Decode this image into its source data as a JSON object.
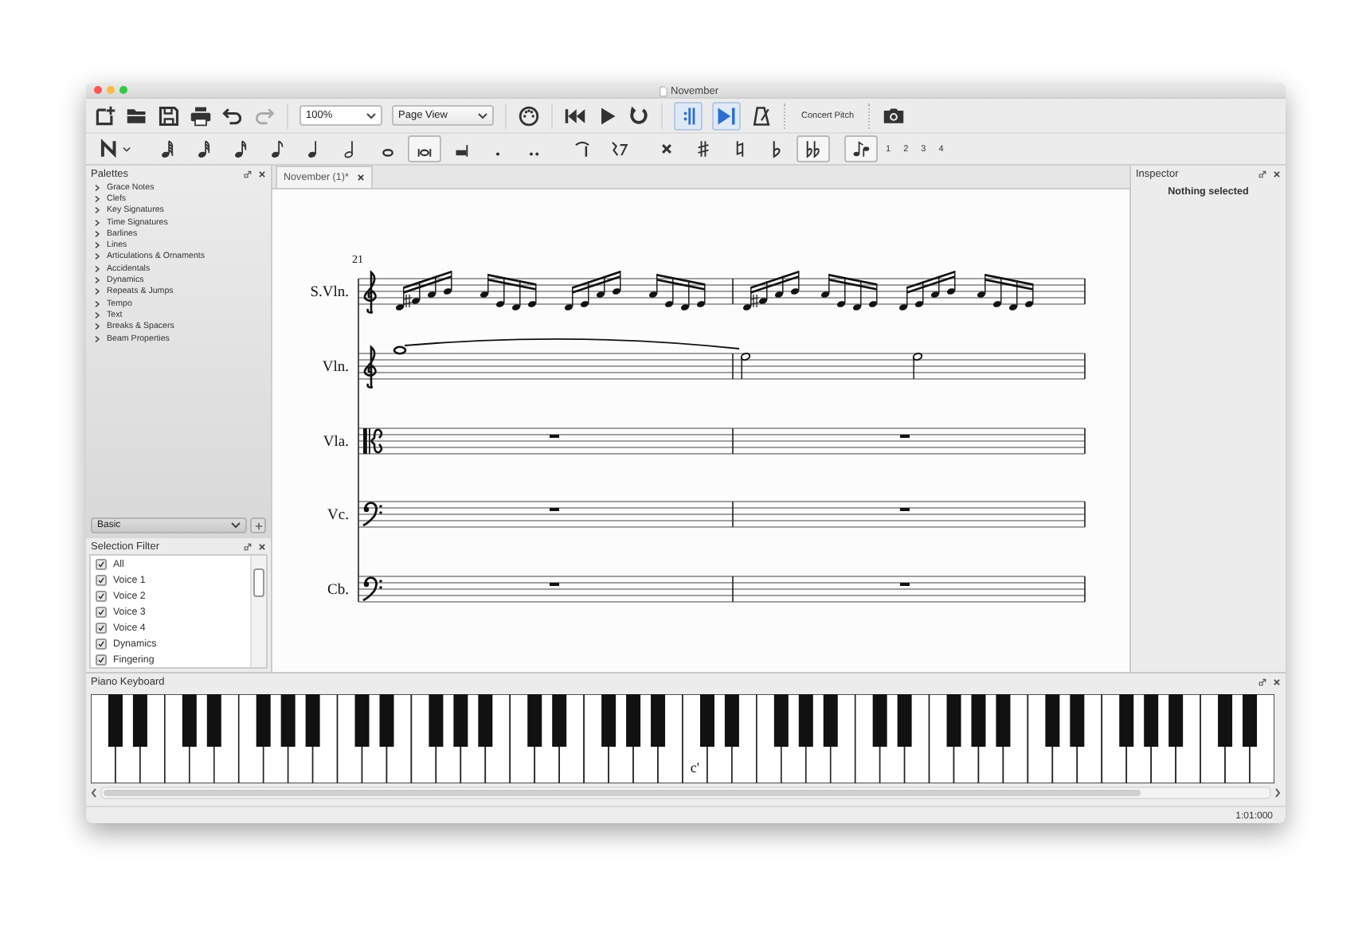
{
  "window": {
    "title": "November"
  },
  "toolbar": {
    "zoom": "100%",
    "view_mode": "Page View",
    "playback_toggles": [
      {
        "kind": "repeat",
        "selected": true
      },
      {
        "kind": "pan",
        "selected": true
      }
    ],
    "concert_pitch": {
      "label": "Concert Pitch",
      "selected": false
    }
  },
  "note_input": {
    "buttons": [
      {
        "kind": "noteinput",
        "selected": false
      },
      {
        "kind": "sixtyfourth",
        "selected": false
      },
      {
        "kind": "thirtysecond",
        "selected": false
      },
      {
        "kind": "sixteenth",
        "selected": false
      },
      {
        "kind": "eighth",
        "selected": false
      },
      {
        "kind": "quarter",
        "selected": false
      },
      {
        "kind": "half",
        "selected": false
      },
      {
        "kind": "whole",
        "selected": false
      },
      {
        "kind": "breve",
        "selected": true
      },
      {
        "kind": "longa",
        "selected": false
      },
      {
        "kind": "dot",
        "selected": false
      },
      {
        "kind": "doubledot",
        "selected": false
      },
      {
        "kind": "tie",
        "selected": false
      },
      {
        "kind": "rest",
        "selected": false
      },
      {
        "kind": "doublesharp",
        "selected": false
      },
      {
        "kind": "sharp",
        "selected": false
      },
      {
        "kind": "natural",
        "selected": false
      },
      {
        "kind": "flat",
        "selected": false
      },
      {
        "kind": "doubleflat",
        "selected": true
      },
      {
        "kind": "flip",
        "selected": true
      }
    ],
    "voices": [
      "1",
      "2",
      "3",
      "4"
    ]
  },
  "palettes": {
    "title": "Palettes",
    "items": [
      {
        "label": "Grace Notes",
        "expanded": false
      },
      {
        "label": "Clefs",
        "expanded": false
      },
      {
        "label": "Key Signatures",
        "expanded": false
      },
      {
        "label": "Time Signatures",
        "expanded": false
      },
      {
        "label": "Barlines",
        "expanded": false
      },
      {
        "label": "Lines",
        "expanded": false
      },
      {
        "label": "Articulations & Ornaments",
        "expanded": false
      },
      {
        "label": "Accidentals",
        "expanded": false
      },
      {
        "label": "Dynamics",
        "expanded": false
      },
      {
        "label": "Repeats & Jumps",
        "expanded": false
      },
      {
        "label": "Tempo",
        "expanded": false
      },
      {
        "label": "Text",
        "expanded": false
      },
      {
        "label": "Breaks & Spacers",
        "expanded": false
      },
      {
        "label": "Beam Properties",
        "expanded": false
      }
    ],
    "workspace": "Basic"
  },
  "selection_filter": {
    "title": "Selection Filter",
    "items": [
      {
        "label": "All",
        "checked": true
      },
      {
        "label": "Voice 1",
        "checked": true
      },
      {
        "label": "Voice 2",
        "checked": true
      },
      {
        "label": "Voice 3",
        "checked": true
      },
      {
        "label": "Voice 4",
        "checked": true
      },
      {
        "label": "Dynamics",
        "checked": true
      },
      {
        "label": "Fingering",
        "checked": true
      }
    ]
  },
  "score_tabs": [
    {
      "label": "November (1)*",
      "selected": true
    }
  ],
  "score": {
    "measure_number": "21",
    "staves": [
      {
        "name": "S.Vln.",
        "kind": "treble"
      },
      {
        "name": "Vln.",
        "kind": "treble"
      },
      {
        "name": "Vla.",
        "kind": "alto"
      },
      {
        "name": "Vc.",
        "kind": "bass"
      },
      {
        "name": "Cb.",
        "kind": "bass"
      }
    ]
  },
  "inspector": {
    "title": "Inspector",
    "message": "Nothing selected"
  },
  "piano_keyboard": {
    "title": "Piano Keyboard",
    "key_label": "c'"
  },
  "status_bar": {
    "position": "1:01:000"
  }
}
